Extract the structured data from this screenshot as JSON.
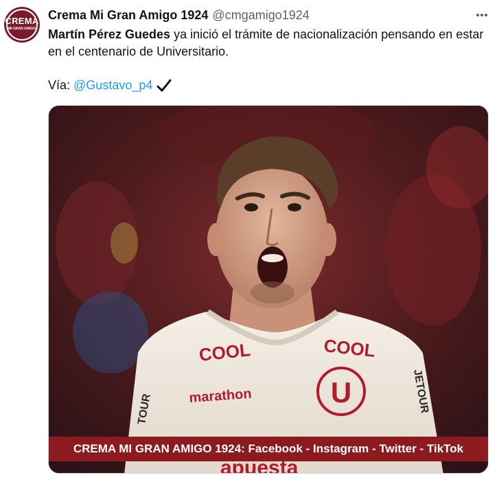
{
  "tweet": {
    "author": {
      "display_name": "Crema Mi Gran Amigo 1924",
      "handle": "@cmgamigo1924",
      "avatar_text": "CREMA",
      "avatar_subtext": "MI GRAN AMIGO"
    },
    "text_bold": "Martín Pérez Guedes",
    "text_rest": " ya inició el trámite de nacionalización pensando en estar en el centenario de Universitario.",
    "via_label": "Vía:",
    "via_mention": "@Gustavo_p4",
    "check_symbol": "✔",
    "more_icon": "more-horizontal-icon"
  },
  "media": {
    "banner_text": "CREMA MI GRAN AMIGO 1924: Facebook - Instagram - Twitter - TikTok",
    "jersey": {
      "sponsor_left": "COOL",
      "sponsor_right": "COOL",
      "chest_text": "marathon",
      "crest_letter": "U",
      "sleeve_right": "JETOUR",
      "sleeve_left": "TOUR",
      "bottom_text": "apuesta"
    }
  },
  "colors": {
    "link": "#1d9bf0",
    "banner": "#8c1a1f",
    "jersey_red": "#b01c2e",
    "jersey_cream": "#f3ece3"
  }
}
